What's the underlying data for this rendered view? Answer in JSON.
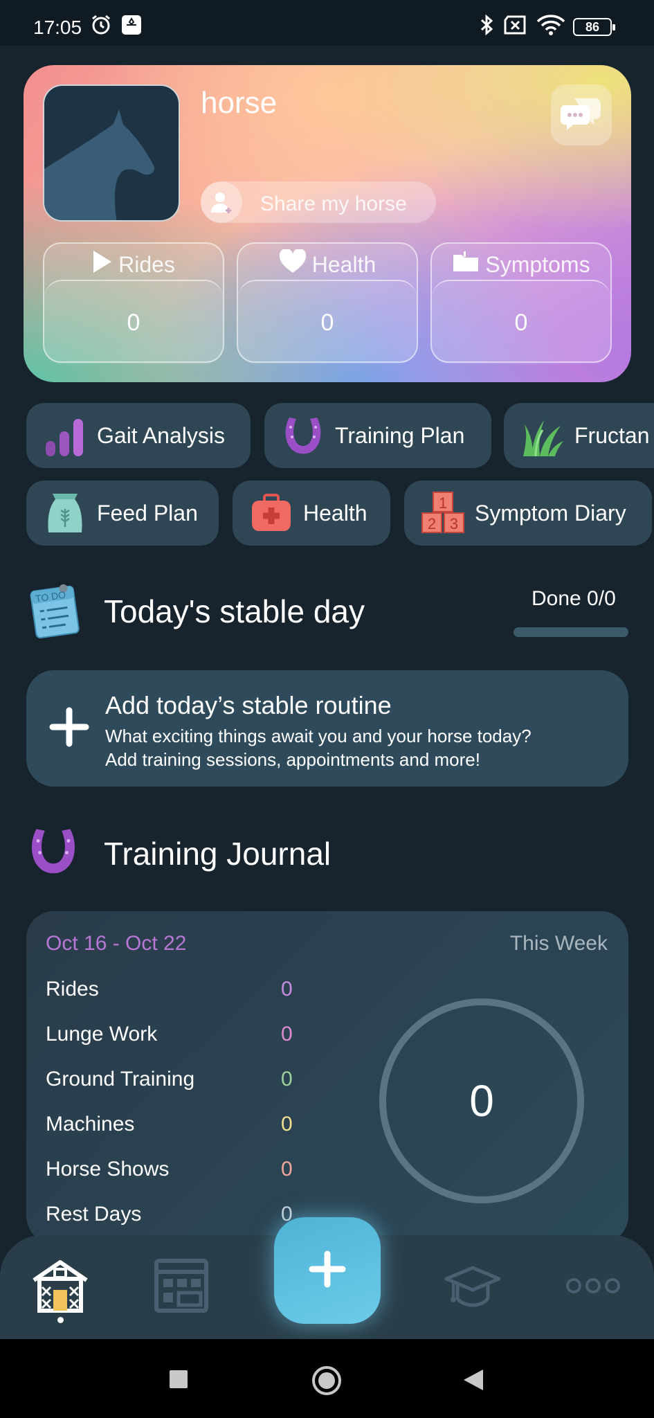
{
  "status_bar": {
    "time": "17:05",
    "battery": "86"
  },
  "profile": {
    "horse_name": "horse",
    "share_label": "Share my horse",
    "stats": [
      {
        "label": "Rides",
        "value": "0"
      },
      {
        "label": "Health",
        "value": "0"
      },
      {
        "label": "Symptoms",
        "value": "0"
      }
    ]
  },
  "quick_actions": {
    "row1": [
      "Gait Analysis",
      "Training Plan",
      "Fructan"
    ],
    "row2": [
      "Feed Plan",
      "Health",
      "Symptom Diary"
    ]
  },
  "today": {
    "title": "Today's stable day",
    "done": "Done 0/0",
    "add_title": "Add today’s stable routine",
    "add_line1": "What exciting things await you and your horse today?",
    "add_line2": "Add training sessions, appointments and more!"
  },
  "journal": {
    "title": "Training Journal",
    "range": "Oct 16 - Oct 22",
    "period": "This Week",
    "total": "0",
    "rows": [
      {
        "label": "Rides",
        "value": "0",
        "color": "#c58be0"
      },
      {
        "label": "Lunge Work",
        "value": "0",
        "color": "#e08bd0"
      },
      {
        "label": "Ground Training",
        "value": "0",
        "color": "#9fd19a"
      },
      {
        "label": "Machines",
        "value": "0",
        "color": "#f2e08f"
      },
      {
        "label": "Horse Shows",
        "value": "0",
        "color": "#f2a79a"
      },
      {
        "label": "Rest Days",
        "value": "0",
        "color": "#c9d2d8"
      }
    ]
  },
  "nav": {
    "items": [
      "stable-icon",
      "calendar-icon",
      "add-icon",
      "graduation-cap-icon",
      "more-icon"
    ]
  },
  "colors": {
    "background": "#17242e",
    "accent": "#6ccbe8",
    "card": "#2f4654"
  }
}
